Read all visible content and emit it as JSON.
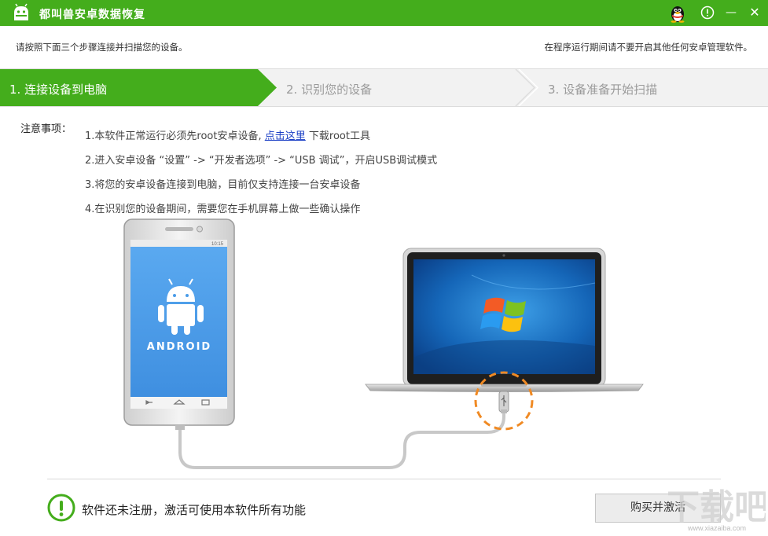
{
  "window": {
    "title": "都叫兽安卓数据恢复"
  },
  "titlebar": {
    "qq_icon": "qq-penguin-icon",
    "info_icon": "info-icon",
    "min_label": "—",
    "close_label": "✕"
  },
  "hints": {
    "left": "请按照下面三个步骤连接并扫描您的设备。",
    "right": "在程序运行期间请不要开启其他任何安卓管理软件。"
  },
  "steps": [
    {
      "label": "1. 连接设备到电脑",
      "active": true
    },
    {
      "label": "2. 识别您的设备",
      "active": false
    },
    {
      "label": "3. 设备准备开始扫描",
      "active": false
    }
  ],
  "notes": {
    "title": "注意事项：",
    "item1_prefix": "1.本软件正常运行必须先root安卓设备,",
    "item1_link": "点击这里",
    "item1_suffix": "下载root工具",
    "item2": "2.进入安卓设备 “设置” -> “开发者选项” -> “USB 调试”，开启USB调试模式",
    "item3": "3.将您的安卓设备连接到电脑，目前仅支持连接一台安卓设备",
    "item4": "4.在识别您的设备期间，需要您在手机屏幕上做一些确认操作"
  },
  "phone": {
    "status_time": "10:15",
    "brand": "ANDROID"
  },
  "footer": {
    "message": "软件还未注册，激活可使用本软件所有功能",
    "buy_button": "购买并激活",
    "watermark": "下载吧",
    "watermark_url": "www.xiazaiba.com"
  },
  "colors": {
    "accent": "#44ad1c",
    "link": "#1a3ec5",
    "usb_circle": "#f08a24"
  }
}
